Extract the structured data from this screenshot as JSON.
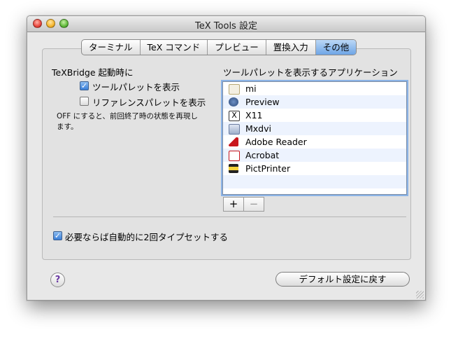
{
  "window": {
    "title": "TeX Tools 設定"
  },
  "tabs": [
    {
      "label": "ターミナル"
    },
    {
      "label": "TeX コマンド"
    },
    {
      "label": "プレビュー"
    },
    {
      "label": "置換入力"
    },
    {
      "label": "その他"
    }
  ],
  "texbridge": {
    "heading": "TeXBridge 起動時に",
    "show_tool_palette": {
      "label": "ツールパレットを表示",
      "checked": true
    },
    "show_reference_palette": {
      "label": "リファレンスパレットを表示",
      "checked": false
    },
    "note": "OFF にすると、前回終了時の状態を再現します。"
  },
  "apps": {
    "heading": "ツールパレットを表示するアプリケーション",
    "items": [
      {
        "name": "mi",
        "icon": "mi-app-icon"
      },
      {
        "name": "Preview",
        "icon": "preview-app-icon"
      },
      {
        "name": "X11",
        "icon": "x11-app-icon"
      },
      {
        "name": "Mxdvi",
        "icon": "mxdvi-app-icon"
      },
      {
        "name": "Adobe Reader",
        "icon": "adobe-reader-icon"
      },
      {
        "name": "Acrobat",
        "icon": "acrobat-icon"
      },
      {
        "name": "PictPrinter",
        "icon": "pictprinter-icon"
      }
    ],
    "add_label": "+",
    "remove_label": "−"
  },
  "auto_typeset": {
    "label": "必要ならば自動的に2回タイプセットする",
    "checked": true
  },
  "footer": {
    "help_label": "?",
    "reset_label": "デフォルト設定に戻す"
  },
  "colors": {
    "accent": "#3a7fd8",
    "selected_tab": "#6ea5e6"
  }
}
